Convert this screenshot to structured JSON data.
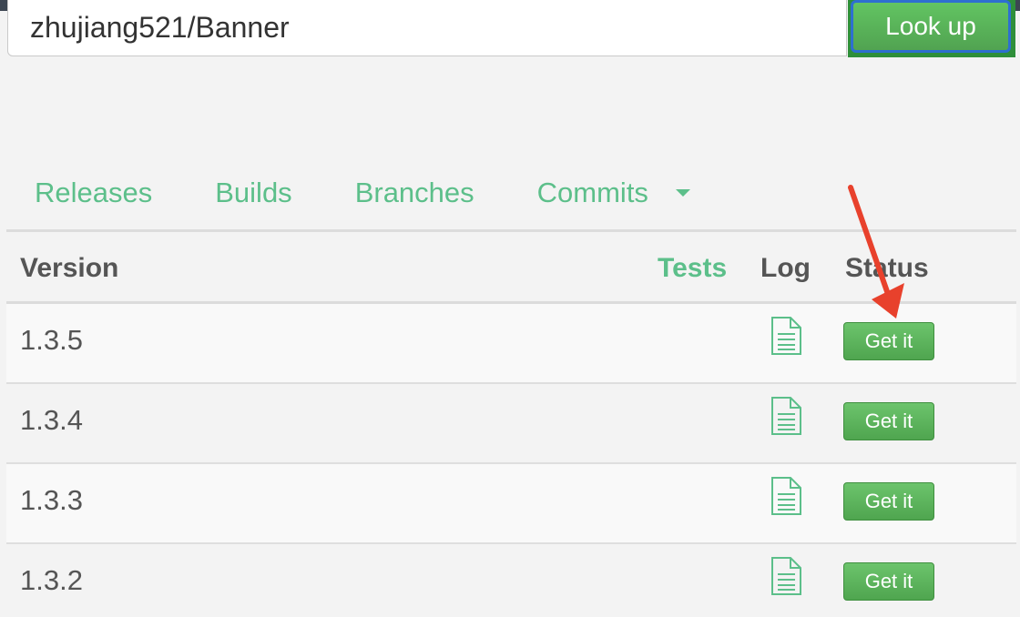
{
  "search": {
    "value": "zhujiang521/Banner"
  },
  "lookup": {
    "label": "Look up"
  },
  "tabs": [
    {
      "label": "Releases"
    },
    {
      "label": "Builds"
    },
    {
      "label": "Branches"
    },
    {
      "label": "Commits"
    }
  ],
  "table": {
    "headers": {
      "version": "Version",
      "tests": "Tests",
      "log": "Log",
      "status": "Status"
    },
    "rows": [
      {
        "version": "1.3.5",
        "action": "Get it"
      },
      {
        "version": "1.3.4",
        "action": "Get it"
      },
      {
        "version": "1.3.3",
        "action": "Get it"
      },
      {
        "version": "1.3.2",
        "action": "Get it"
      }
    ]
  },
  "colors": {
    "accent": "#5cbf8a",
    "button_green": "#5cb85c",
    "annotation_arrow": "#e8412c"
  },
  "icons": {
    "log": "document-icon",
    "commits_menu": "caret-down-icon"
  }
}
